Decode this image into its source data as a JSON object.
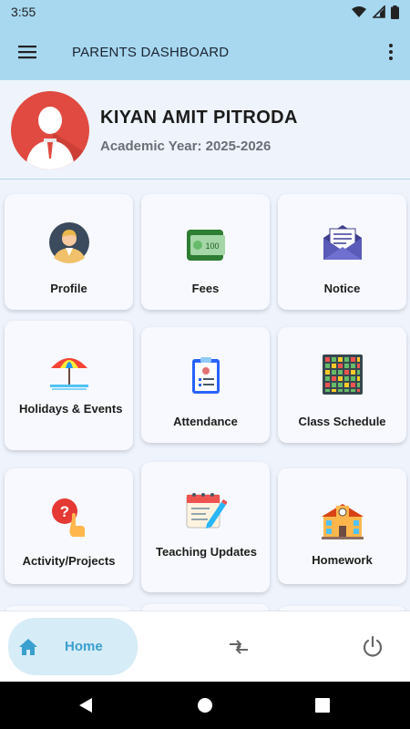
{
  "status_bar": {
    "time": "3:55",
    "icons": [
      "wifi-icon",
      "signal-icon",
      "battery-icon"
    ]
  },
  "app_bar": {
    "title": "PARENTS DASHBOARD",
    "menu_icon": "hamburger-menu-icon",
    "more_icon": "more-vert-icon"
  },
  "student": {
    "name": "KIYAN AMIT PITRODA",
    "academic_year": "Academic Year: 2025-2026",
    "avatar_icon": "student-avatar-icon"
  },
  "tiles": [
    {
      "label": "Profile",
      "icon": "profile-person-icon"
    },
    {
      "label": "Fees",
      "icon": "money-wallet-icon"
    },
    {
      "label": "Notice",
      "icon": "envelope-notice-icon"
    },
    {
      "label": "Holidays & Events",
      "icon": "beach-umbrella-icon"
    },
    {
      "label": "Attendance",
      "icon": "clipboard-checklist-icon"
    },
    {
      "label": "Class Schedule",
      "icon": "calendar-grid-icon"
    },
    {
      "label": "Activity/Projects",
      "icon": "question-hand-icon"
    },
    {
      "label": "Teaching Updates",
      "icon": "calendar-pencil-icon"
    },
    {
      "label": "Homework",
      "icon": "school-building-icon"
    }
  ],
  "bottom_nav": {
    "home_label": "Home",
    "home_icon": "home-icon",
    "switch_icon": "switch-arrows-icon",
    "logout_icon": "power-icon"
  },
  "system_nav": [
    "back-icon",
    "home-circle-icon",
    "recents-icon"
  ],
  "colors": {
    "app_bar": "#a7d8f0",
    "background": "#eef3fc",
    "accent": "#3aa0d0",
    "home_pill": "#d6ecf7",
    "avatar": "#e04a40"
  }
}
